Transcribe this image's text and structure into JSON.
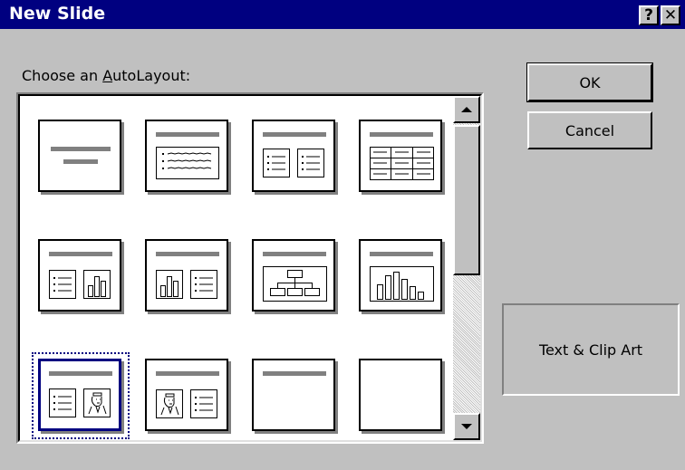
{
  "window": {
    "title": "New Slide",
    "help_button": "?",
    "close_button": "✕"
  },
  "chooser": {
    "label_prefix": "Choose an ",
    "label_accel": "A",
    "label_suffix": "utoLayout:",
    "selected_layout": "Text & Clip Art"
  },
  "buttons": {
    "ok": "OK",
    "cancel": "Cancel"
  },
  "preview": {
    "text": "Text & Clip Art"
  },
  "layouts": [
    {
      "name": "title-slide"
    },
    {
      "name": "bulleted-list"
    },
    {
      "name": "two-column-text"
    },
    {
      "name": "table"
    },
    {
      "name": "text-and-chart"
    },
    {
      "name": "chart-and-text"
    },
    {
      "name": "organization-chart"
    },
    {
      "name": "chart"
    },
    {
      "name": "text-and-clip-art",
      "selected": true
    },
    {
      "name": "clip-art-and-text"
    },
    {
      "name": "title-only"
    },
    {
      "name": "blank"
    }
  ],
  "colors": {
    "title_bar": "#000080",
    "dialog_face": "#c0c0c0",
    "selection": "#000080"
  }
}
